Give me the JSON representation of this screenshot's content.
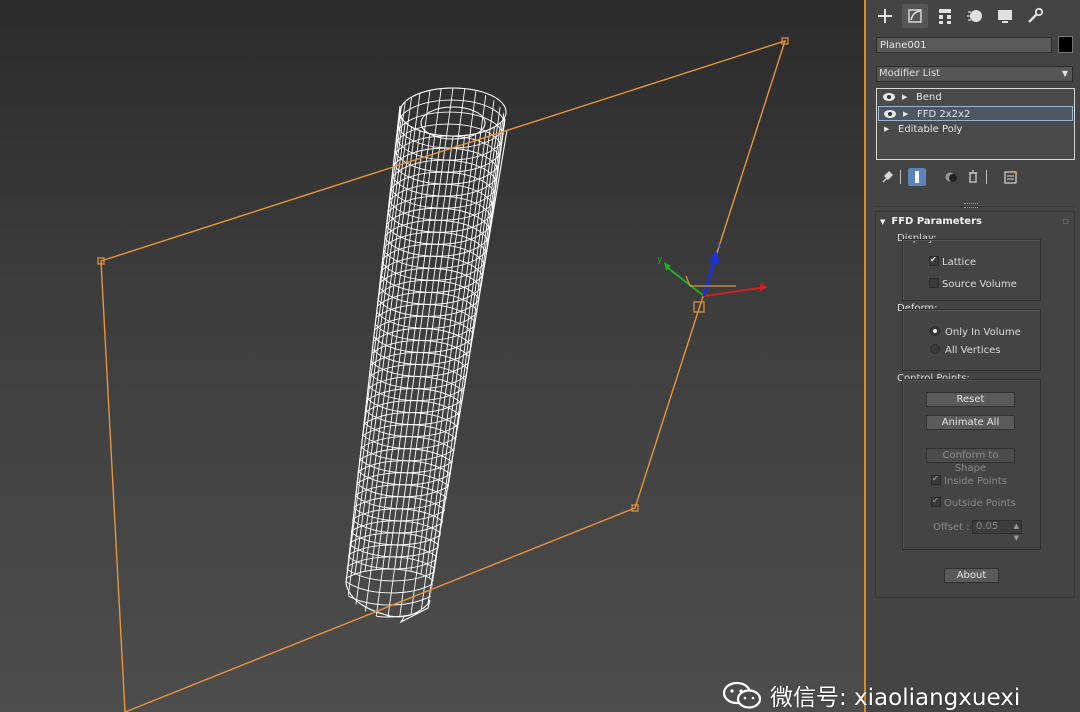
{
  "command_panel": {
    "tabs": [
      {
        "icon": "create-plus-icon",
        "active": false
      },
      {
        "icon": "modify-icon",
        "active": true
      },
      {
        "icon": "hierarchy-icon",
        "active": false
      },
      {
        "icon": "motion-icon",
        "active": false
      },
      {
        "icon": "display-icon",
        "active": false
      },
      {
        "icon": "utilities-wrench-icon",
        "active": false
      }
    ],
    "object_name": "Plane001",
    "object_color": "#000000",
    "modifier_list_label": "Modifier List",
    "stack": [
      {
        "label": "Bend",
        "visible": true,
        "expandable": true,
        "selected": false
      },
      {
        "label": "FFD 2x2x2",
        "visible": true,
        "expandable": true,
        "selected": true
      },
      {
        "label": "Editable Poly",
        "visible": false,
        "expandable": true,
        "selected": false
      }
    ]
  },
  "ffd_parameters": {
    "title": "FFD Parameters",
    "display": {
      "label": "Display:",
      "lattice": {
        "label": "Lattice",
        "checked": true
      },
      "source_volume": {
        "label": "Source Volume",
        "checked": false
      }
    },
    "deform": {
      "label": "Deform:",
      "only_in_volume": {
        "label": "Only In Volume",
        "selected": true
      },
      "all_vertices": {
        "label": "All Vertices",
        "selected": false
      }
    },
    "control_points": {
      "label": "Control Points:",
      "reset_label": "Reset",
      "animate_all_label": "Animate All",
      "conform_label": "Conform to Shape",
      "inside_points": {
        "label": "Inside Points",
        "checked": true
      },
      "outside_points": {
        "label": "Outside Points",
        "checked": true
      },
      "offset_label": "Offset :",
      "offset_value": "0.05"
    },
    "about_label": "About"
  },
  "viewport": {
    "gizmo_axes": {
      "x": "x",
      "y": "y",
      "z": "z"
    },
    "colors": {
      "selection": "#e8963a",
      "x_axis": "#d02020",
      "y_axis": "#1fae2e",
      "z_axis": "#1a30d8"
    }
  },
  "watermark": "微信号: xiaoliangxuexi"
}
